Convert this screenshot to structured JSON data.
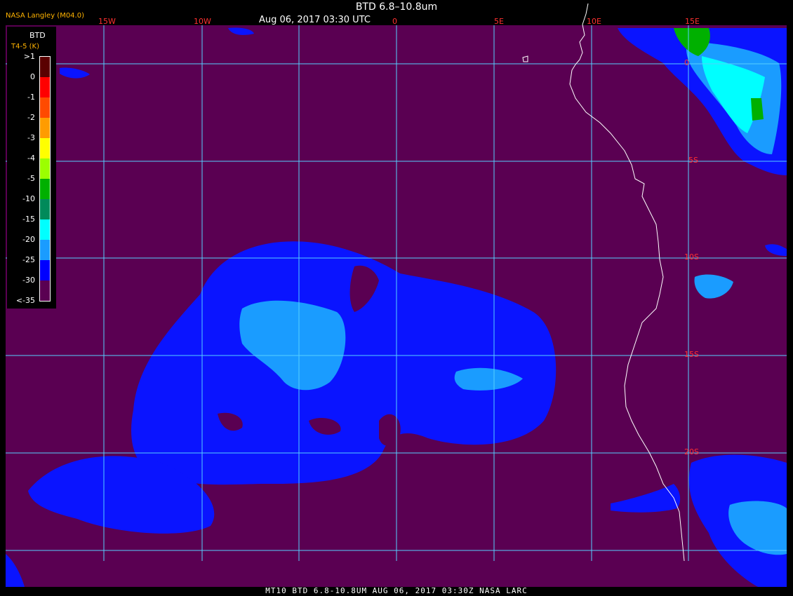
{
  "header": {
    "title": "BTD 6.8–10.8um",
    "datetime": "Aug 06, 2017 03:30 UTC",
    "brand": "NASA Langley (M04.0)"
  },
  "grid": {
    "lon_labels": [
      "15W",
      "10W",
      "0",
      "5E",
      "10E",
      "15E"
    ],
    "lat_labels": [
      "0",
      "5S",
      "10S",
      "15S",
      "20S"
    ]
  },
  "legend": {
    "title": "BTD",
    "subtitle": "T4-5 (K)",
    "labels": [
      ">1",
      "0",
      "-1",
      "-2",
      "-3",
      "-4",
      "-5",
      "-10",
      "-15",
      "-20",
      "-25",
      "-30",
      "<-35"
    ],
    "colors": [
      "#5a0000",
      "#ff0000",
      "#ff4a00",
      "#ff9c00",
      "#ffff00",
      "#9cff00",
      "#00b000",
      "#008a5a",
      "#00ffff",
      "#1a9cff",
      "#0000ff",
      "#5a0052"
    ]
  },
  "colors": {
    "background": "#5a0052",
    "grid": "#55cfff",
    "coast": "#ffffff"
  },
  "footer": {
    "text": "MT10  BTD 6.8-10.8UM   AUG 06, 2017 03:30Z   NASA LARC"
  }
}
